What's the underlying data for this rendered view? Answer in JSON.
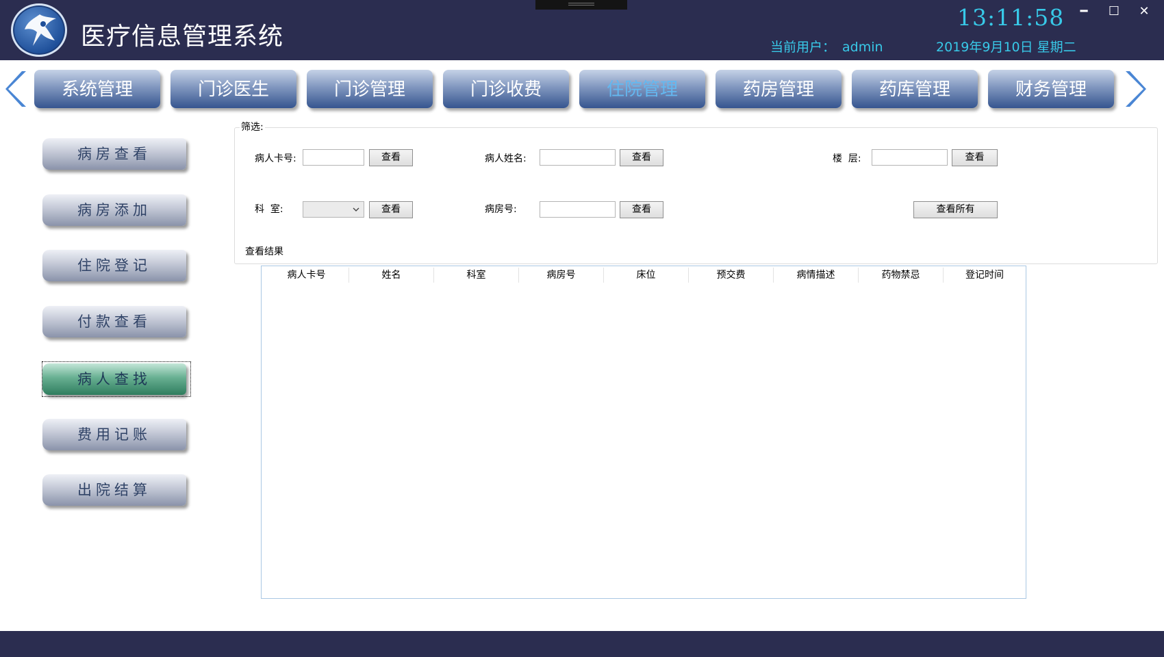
{
  "header": {
    "app_title": "医疗信息管理系统",
    "time": "13:11:58",
    "user_label": "当前用户：",
    "user_name": "admin",
    "date": "2019年9月10日 星期二",
    "window": {
      "minimize": "━",
      "maximize": "☐",
      "close": "✕"
    }
  },
  "nav": {
    "tabs": [
      {
        "label": "系统管理"
      },
      {
        "label": "门诊医生"
      },
      {
        "label": "门诊管理"
      },
      {
        "label": "门诊收费"
      },
      {
        "label": "住院管理",
        "active": true
      },
      {
        "label": "药房管理"
      },
      {
        "label": "药库管理"
      },
      {
        "label": "财务管理"
      }
    ]
  },
  "sidebar": {
    "items": [
      {
        "label": "病房查看"
      },
      {
        "label": "病房添加"
      },
      {
        "label": "住院登记"
      },
      {
        "label": "付款查看"
      },
      {
        "label": "病人查找",
        "active": true
      },
      {
        "label": "费用记账"
      },
      {
        "label": "出院结算"
      }
    ]
  },
  "filter": {
    "legend": "筛选:",
    "card_no_label": "病人卡号:",
    "card_no_value": "",
    "name_label": "病人姓名:",
    "name_value": "",
    "floor_label": "楼  层:",
    "floor_value": "",
    "dept_label": "科  室:",
    "dept_value": "",
    "ward_label": "病房号:",
    "ward_value": "",
    "view_button": "查看",
    "view_all_button": "查看所有",
    "result_label": "查看结果"
  },
  "grid": {
    "columns": [
      "病人卡号",
      "姓名",
      "科室",
      "病房号",
      "床位",
      "预交费",
      "病情描述",
      "药物禁忌",
      "登记时间"
    ],
    "rows": []
  },
  "colors": {
    "header_bg": "#2b2d50",
    "accent_cyan": "#38c9e8",
    "active_tab_text": "#64b8f0",
    "active_side_green": "#2f7d5e"
  }
}
